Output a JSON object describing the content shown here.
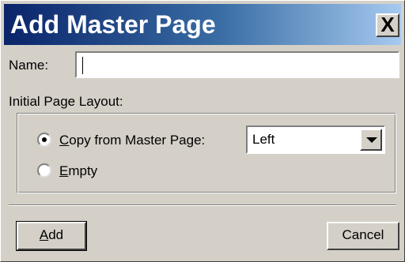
{
  "dialog": {
    "title": "Add Master Page",
    "close_label": "X"
  },
  "name": {
    "label": "Name:",
    "value": ""
  },
  "layout": {
    "label": "Initial Page Layout:",
    "options": [
      {
        "label_underlined": "C",
        "label_rest": "opy from Master Page:",
        "checked": true
      },
      {
        "label_underlined": "E",
        "label_rest": "mpty",
        "checked": false
      }
    ],
    "master_page_select": {
      "value": "Left"
    }
  },
  "buttons": {
    "add_underlined": "A",
    "add_rest": "dd",
    "cancel": "Cancel"
  },
  "colors": {
    "face": "#d4d0c8",
    "title_gradient_start": "#0a246a",
    "title_gradient_end": "#a6caf0"
  }
}
